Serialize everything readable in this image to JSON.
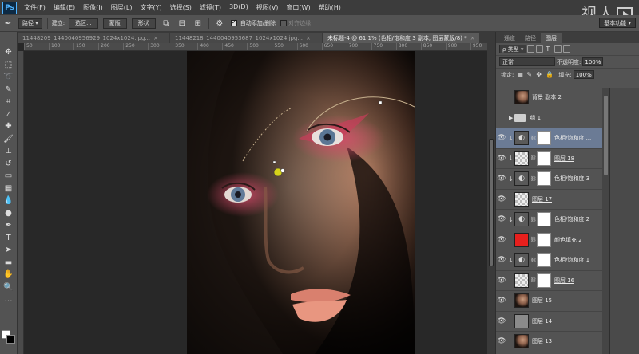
{
  "app": {
    "logo": "Ps"
  },
  "menu": [
    "文件(F)",
    "编辑(E)",
    "图像(I)",
    "图层(L)",
    "文字(Y)",
    "选择(S)",
    "滤镜(T)",
    "3D(D)",
    "视图(V)",
    "窗口(W)",
    "帮助(H)"
  ],
  "watermark": "视人",
  "options": {
    "mode_select": "路径",
    "create_label": "建立:",
    "selection_btn": "选区...",
    "mask_btn": "蒙版",
    "shape_btn": "形状",
    "auto_add_delete": "自动添加/删除",
    "align_edges": "对齐边缘",
    "workspace": "基本功能"
  },
  "tabs": [
    {
      "label": "11448209_1440040956929_1024x1024.jpg...",
      "active": false
    },
    {
      "label": "11448218_1440040953687_1024x1024.jpg...",
      "active": false
    },
    {
      "label": "未标题-4 @ 61.1% (色相/饱和度 3 副本, 图层蒙版/8) *",
      "active": true
    }
  ],
  "ruler_marks": [
    "50",
    "100",
    "150",
    "200",
    "250",
    "300",
    "350",
    "400",
    "450",
    "500",
    "550",
    "600",
    "650",
    "700",
    "750",
    "800",
    "850",
    "900",
    "950"
  ],
  "panel": {
    "tabs": [
      "通道",
      "路径",
      "图层"
    ],
    "active_tab": "图层",
    "kind_select": "类型",
    "blend_select": "正常",
    "opacity_label": "不透明度:",
    "opacity_value": "100%",
    "lock_label": "锁定:",
    "fill_label": "填充:",
    "fill_value": "100%"
  },
  "layers": [
    {
      "name": "背景 副本 2",
      "visible": false,
      "thumb": "photo",
      "mask": false
    },
    {
      "name": "组 1",
      "visible": false,
      "group": true
    },
    {
      "name": "色相/饱和度 ...",
      "visible": true,
      "thumb": "adj",
      "mask": true,
      "clip": true,
      "selected": true
    },
    {
      "name": "图层 18",
      "visible": true,
      "thumb": "trans",
      "mask": true,
      "clip": true,
      "underline": true
    },
    {
      "name": "色相/饱和度 3",
      "visible": true,
      "thumb": "adj",
      "mask": true,
      "clip": true
    },
    {
      "name": "图层 17",
      "visible": true,
      "thumb": "trans",
      "mask": false,
      "underline": true
    },
    {
      "name": "色相/饱和度 2",
      "visible": true,
      "thumb": "adj",
      "mask": true,
      "clip": true
    },
    {
      "name": "颜色填充 2",
      "visible": true,
      "thumb": "red",
      "mask": true,
      "clip": false
    },
    {
      "name": "色相/饱和度 1",
      "visible": true,
      "thumb": "adj",
      "mask": true,
      "clip": true
    },
    {
      "name": "图层 16",
      "visible": true,
      "thumb": "trans",
      "mask": true,
      "underline": true
    },
    {
      "name": "图层 15",
      "visible": true,
      "thumb": "photo",
      "mask": false
    },
    {
      "name": "图层 14",
      "visible": true,
      "thumb": "gray",
      "mask": false
    },
    {
      "name": "图层 13",
      "visible": true,
      "thumb": "photo",
      "mask": false
    }
  ]
}
